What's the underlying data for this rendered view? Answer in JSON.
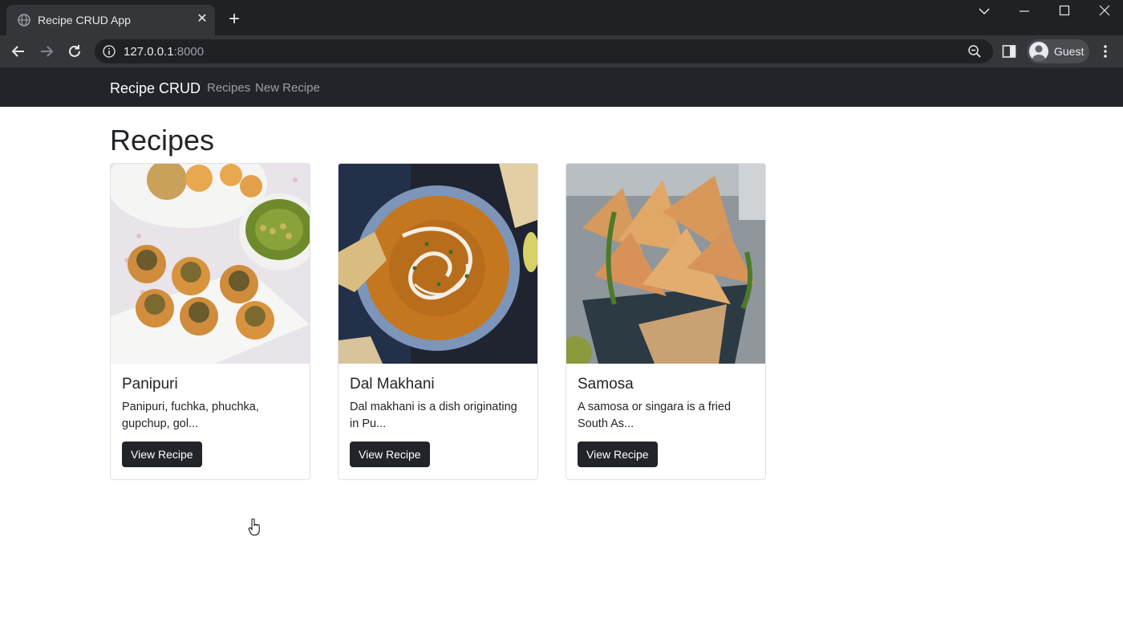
{
  "browser": {
    "tab_title": "Recipe CRUD App",
    "url_host": "127.0.0.1",
    "url_port": ":8000",
    "profile_label": "Guest"
  },
  "site": {
    "brand": "Recipe CRUD",
    "nav": [
      "Recipes",
      "New Recipe"
    ]
  },
  "page": {
    "heading": "Recipes"
  },
  "recipes": [
    {
      "title": "Panipuri",
      "excerpt": "Panipuri, fuchka, phuchka, gupchup, gol...",
      "button": "View Recipe"
    },
    {
      "title": "Dal Makhani",
      "excerpt": "Dal makhani is a dish originating in Pu...",
      "button": "View Recipe"
    },
    {
      "title": "Samosa",
      "excerpt": "A samosa or singara is a fried South As...",
      "button": "View Recipe"
    }
  ]
}
